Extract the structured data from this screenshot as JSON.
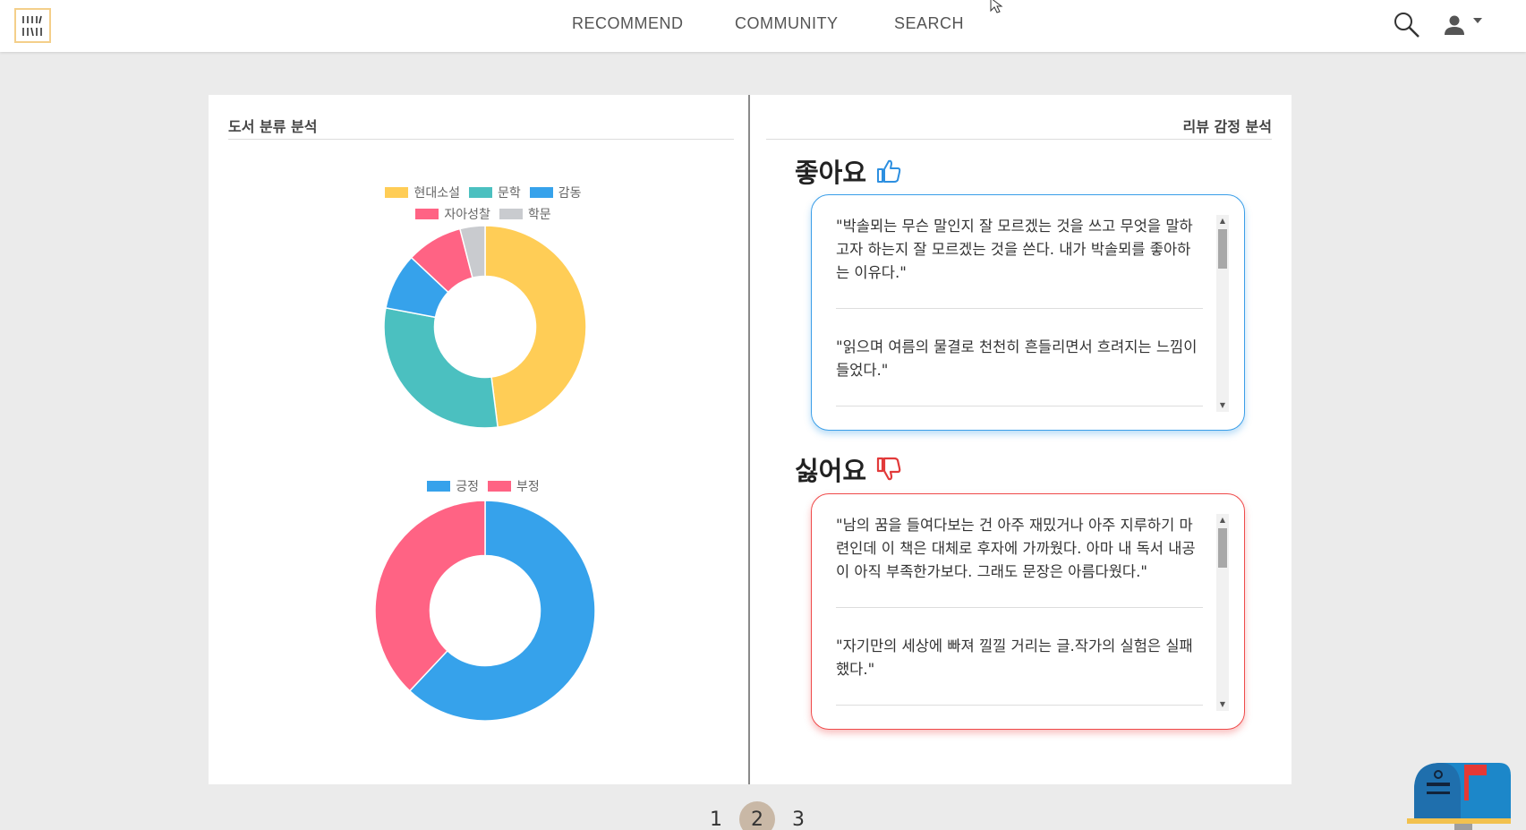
{
  "nav": {
    "links": [
      "RECOMMEND",
      "COMMUNITY",
      "SEARCH"
    ]
  },
  "left_page": {
    "title": "도서 분류 분석"
  },
  "right_page": {
    "title": "리뷰 감정 분석",
    "like": {
      "heading": "좋아요",
      "reviews": [
        "\"박솔뫼는 무슨 말인지 잘 모르겠는 것을 쓰고 무엇을 말하고자 하는지 잘 모르겠는 것을 쓴다. 내가 박솔뫼를 좋아하는 이유다.\"",
        "\"읽으며 여름의 물결로 천천히 흔들리면서 흐려지는 느낌이 들었다.\""
      ]
    },
    "dislike": {
      "heading": "싫어요",
      "reviews": [
        "\"남의 꿈을 들여다보는 건 아주 재밌거나 아주 지루하기 마련인데 이 책은 대체로 후자에 가까웠다. 아마 내 독서 내공이 아직 부족한가보다. 그래도 문장은 아름다웠다.\"",
        "\"자기만의 세상에 빠져 낄낄 거리는 글.작가의 실험은 실패했다.\""
      ]
    }
  },
  "chart_data": [
    {
      "type": "pie",
      "categories": [
        "현대소설",
        "문학",
        "감동",
        "자아성찰",
        "학문"
      ],
      "values": [
        48,
        30,
        9,
        9,
        4
      ],
      "colors": [
        "#ffcd56",
        "#4bc0c0",
        "#36a2eb",
        "#ff6384",
        "#c9cbcf"
      ],
      "legend_position": "top"
    },
    {
      "type": "pie",
      "categories": [
        "긍정",
        "부정"
      ],
      "values": [
        62,
        38
      ],
      "colors": [
        "#36a2eb",
        "#ff6384"
      ],
      "legend_position": "top"
    }
  ],
  "pagination": {
    "pages": [
      "1",
      "2",
      "3"
    ],
    "current": "2"
  },
  "icons": {
    "logo": "bookshelf-logo-icon",
    "search": "search-icon",
    "user": "user-icon",
    "like": "thumbs-up-icon",
    "dislike": "thumbs-down-icon",
    "mailbox": "mailbox-icon"
  },
  "colors": {
    "like_border": "#3a9ee8",
    "dislike_border": "#ef4a4a",
    "active_page": "#c9b8a6",
    "background": "#ebebeb"
  }
}
